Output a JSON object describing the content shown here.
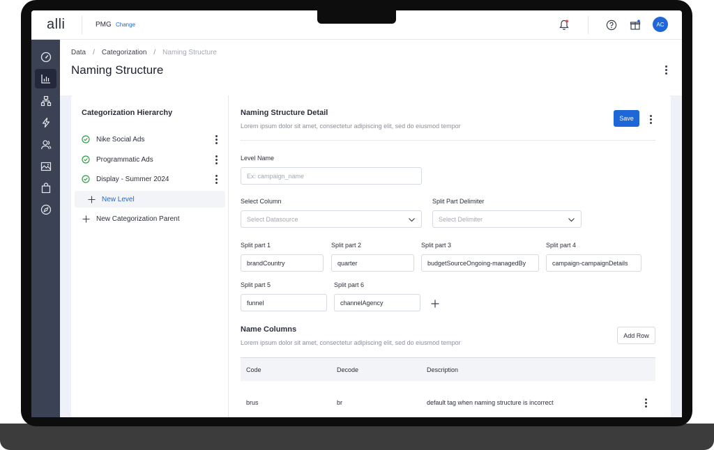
{
  "topbar": {
    "logo": "alli",
    "org": "PMG",
    "change_label": "Change",
    "avatar_initials": "AC",
    "icons": [
      "bell-icon",
      "help-icon",
      "gift-icon"
    ],
    "notification_dot_color": "#e5484d"
  },
  "sidebar": {
    "items": [
      {
        "icon": "dashboard-icon"
      },
      {
        "icon": "chart-icon",
        "active": true
      },
      {
        "icon": "hierarchy-icon"
      },
      {
        "icon": "bolt-icon"
      },
      {
        "icon": "users-icon"
      },
      {
        "icon": "image-icon"
      },
      {
        "icon": "bag-icon"
      },
      {
        "icon": "compass-icon"
      }
    ]
  },
  "breadcrumb": {
    "items": [
      "Data",
      "Categorization",
      "Naming Structure"
    ],
    "separator": "/"
  },
  "page": {
    "title": "Naming Structure"
  },
  "hierarchy": {
    "title": "Categorization Hierarchy",
    "items": [
      {
        "label": "Nike Social Ads"
      },
      {
        "label": "Programmatic Ads"
      },
      {
        "label": "Display - Summer 2024"
      }
    ],
    "new_level_label": "New Level",
    "new_parent_label": "New Categorization Parent"
  },
  "detail": {
    "title": "Naming Structure Detail",
    "subtitle": "Lorem ipsum dolor sit amet, consectetur adipiscing elit, sed do eiusmod tempor",
    "save_label": "Save",
    "level_name": {
      "label": "Level Name",
      "placeholder": "Ex: campaign_name",
      "value": ""
    },
    "select_column": {
      "label": "Select Column",
      "value": "Select Datasource"
    },
    "delimiter": {
      "label": "Split Part Delimiter",
      "value": "Select Delimiter"
    },
    "split_parts": [
      {
        "label": "Split part 1",
        "value": "brandCountry"
      },
      {
        "label": "Split part 2",
        "value": "quarter"
      },
      {
        "label": "Split part 3",
        "value": "budgetSourceOngoing-managedBy"
      },
      {
        "label": "Split part 4",
        "value": "campaign-campaignDetails"
      },
      {
        "label": "Split part 5",
        "value": "funnel"
      },
      {
        "label": "Split part 6",
        "value": "channelAgency"
      }
    ]
  },
  "name_columns": {
    "title": "Name Columns",
    "subtitle": "Lorem ipsum dolor sit amet, consectetur adipiscing elit, sed do eiusmod tempor",
    "add_row_label": "Add Row",
    "headers": [
      "Code",
      "Decode",
      "Description"
    ],
    "rows": [
      {
        "code": "brus",
        "decode": "br",
        "description": "default tag when naming structure is incorrect"
      }
    ]
  },
  "colors": {
    "accent": "#1f66d6",
    "sidebar": "#3b4253",
    "check": "#2e9e44"
  }
}
